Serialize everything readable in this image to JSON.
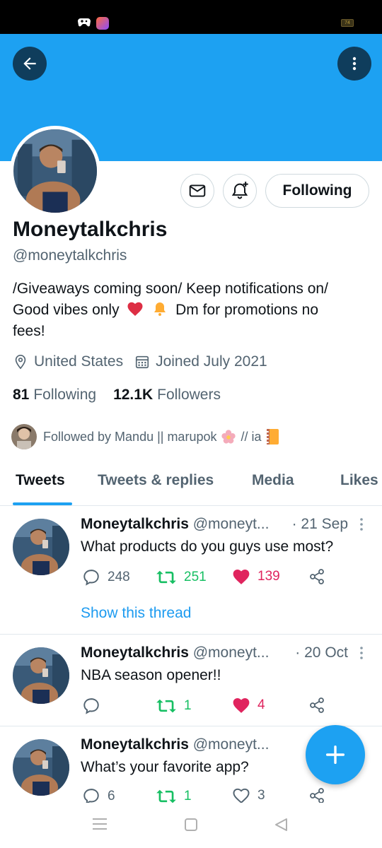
{
  "status_bar": {
    "battery": "74"
  },
  "profile": {
    "name": "Moneytalkchris",
    "handle": "@moneytalkchris",
    "bio_line1": "/Giveaways coming soon/ Keep notifications on/",
    "bio_line2_a": "Good vibes only",
    "bio_line2_b": "Dm for promotions no",
    "bio_line3": "fees!",
    "location": "United States",
    "joined": "Joined July 2021",
    "following_count": "81",
    "following_label": "Following",
    "followers_count": "12.1K",
    "followers_label": "Followers",
    "followed_by": "Followed by Mandu || marupok",
    "followed_by_suffix": "// ia",
    "follow_button": "Following"
  },
  "tabs": [
    "Tweets",
    "Tweets & replies",
    "Media",
    "Likes"
  ],
  "tweets": [
    {
      "name": "Moneytalkchris",
      "handle": "@moneyt...",
      "date": "· 21 Sep",
      "text": "What products do you guys use most?",
      "replies": "248",
      "retweets": "251",
      "likes": "139",
      "liked": true,
      "thread": "Show this thread"
    },
    {
      "name": "Moneytalkchris",
      "handle": "@moneyt...",
      "date": "· 20 Oct",
      "text": "NBA season opener!!",
      "replies": "",
      "retweets": "1",
      "likes": "4",
      "liked": true
    },
    {
      "name": "Moneytalkchris",
      "handle": "@moneyt...",
      "date": "· 1",
      "text": "What’s your favorite app?",
      "replies": "6",
      "retweets": "1",
      "likes": "3",
      "liked": false
    }
  ],
  "colors": {
    "brand": "#1da1f2",
    "retweet": "#17bf63",
    "like": "#e0245e"
  }
}
